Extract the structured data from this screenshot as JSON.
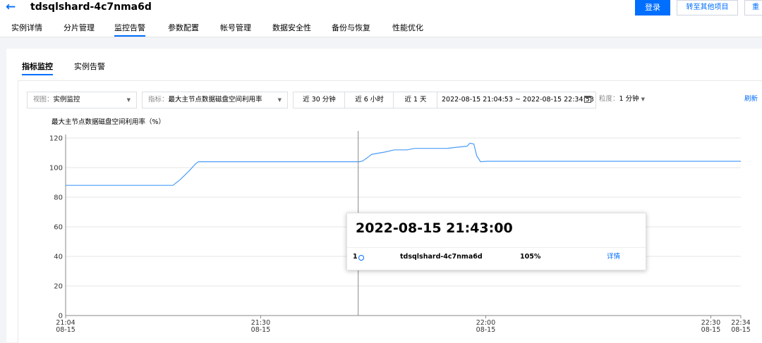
{
  "header": {
    "title": "tdsqlshard-4c7nma6d",
    "login_label": "登录",
    "switch_project_label": "转至其他项目",
    "restart_label": "重"
  },
  "tabs": [
    "实例详情",
    "分片管理",
    "监控告警",
    "参数配置",
    "帐号管理",
    "数据安全性",
    "备份与恢复",
    "性能优化"
  ],
  "active_tab": "监控告警",
  "subtabs": [
    "指标监控",
    "实例告警"
  ],
  "active_subtab": "指标监控",
  "filters": {
    "view_label": "视图：",
    "view_value": "实例监控",
    "metric_label": "指标：",
    "metric_value": "最大主节点数据磁盘空间利用率",
    "quick_ranges": [
      "近 30 分钟",
      "近 6 小时",
      "近 1 天"
    ],
    "date_range": "2022-08-15 21:04:53 ~ 2022-08-15 22:34:53",
    "granularity_label": "粒度：",
    "granularity_value": "1 分钟",
    "refresh_label": "刷新"
  },
  "tooltip": {
    "time": "2022-08-15 21:43:00",
    "index": "1",
    "instance": "tdsqlshard-4c7nma6d",
    "value": "105%",
    "detail_label": "详情"
  },
  "chart_data": {
    "type": "line",
    "title": "最大主节点数据磁盘空间利用率（%）",
    "ylim": [
      0,
      120
    ],
    "yticks": [
      0,
      20,
      40,
      60,
      80,
      100,
      120
    ],
    "xlim": [
      0,
      90
    ],
    "xticks": [
      {
        "t": 0,
        "time": "21:04",
        "date": "08-15"
      },
      {
        "t": 26,
        "time": "21:30",
        "date": "08-15"
      },
      {
        "t": 56,
        "time": "22:00",
        "date": "08-15"
      },
      {
        "t": 86,
        "time": "22:30",
        "date": "08-15"
      },
      {
        "t": 90,
        "time": "22:34",
        "date": "08-15"
      }
    ],
    "grid": true,
    "series": [
      {
        "color": "#4a9df8",
        "points": [
          [
            0,
            88
          ],
          [
            14.3,
            88
          ],
          [
            15.3,
            92
          ],
          [
            16.5,
            98
          ],
          [
            17.3,
            102.5
          ],
          [
            17.7,
            104
          ],
          [
            39.2,
            104
          ],
          [
            39.6,
            104.5
          ],
          [
            40.3,
            107
          ],
          [
            40.8,
            109
          ],
          [
            42.5,
            110.5
          ],
          [
            43.8,
            112
          ],
          [
            45.5,
            112
          ],
          [
            46.5,
            113
          ],
          [
            50.8,
            113
          ],
          [
            53.5,
            114.5
          ],
          [
            53.9,
            116.5
          ],
          [
            54.4,
            116
          ],
          [
            54.8,
            108
          ],
          [
            55.3,
            104
          ],
          [
            56.2,
            104.3
          ],
          [
            90,
            104.3
          ]
        ]
      }
    ],
    "cursor_t": 39
  }
}
